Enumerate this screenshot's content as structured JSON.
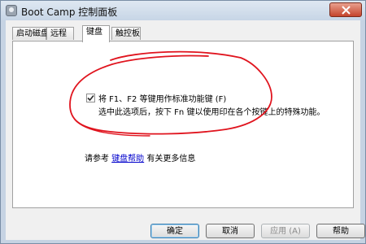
{
  "window": {
    "title": "Boot Camp 控制面板"
  },
  "tabs": [
    {
      "label": "启动磁盘"
    },
    {
      "label": "远程"
    },
    {
      "label": "键盘"
    },
    {
      "label": "触控板"
    }
  ],
  "active_tab": "键盘",
  "keyboard": {
    "checkbox_checked": true,
    "checkbox_label": "将 F1、F2 等键用作标准功能键 (F)",
    "description": "选中此选项后，按下 Fn 键以使用印在各个按键上的特殊功能。",
    "see_also_prefix": "请参考",
    "see_also_link": "键盘帮助",
    "see_also_suffix": "有关更多信息"
  },
  "buttons": {
    "ok": "确定",
    "cancel": "取消",
    "apply": "应用 (A)",
    "help": "帮助"
  },
  "icons": {
    "close": "close-icon",
    "app": "bootcamp-app-icon",
    "check": "checkmark-icon"
  },
  "colors": {
    "annotation": "#e0141e",
    "link": "#0000cc",
    "close_button": "#c4442c"
  }
}
